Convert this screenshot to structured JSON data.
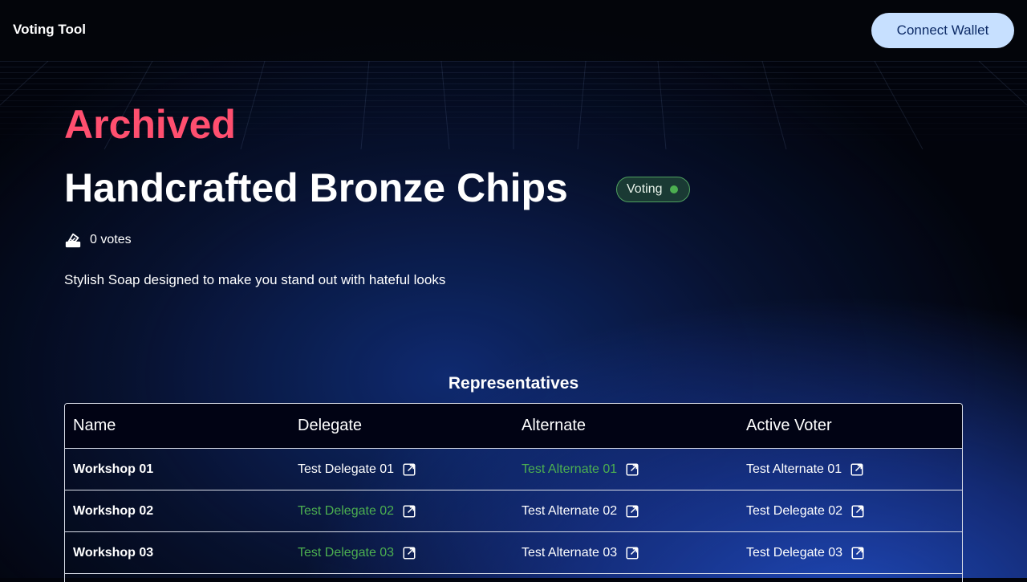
{
  "header": {
    "app_title": "Voting Tool",
    "connect_label": "Connect Wallet"
  },
  "proposal": {
    "status_heading": "Archived",
    "title": "Handcrafted Bronze Chips",
    "badge_label": "Voting",
    "badge_dot_color": "#4caf50",
    "votes_text": "0 votes",
    "description": "Stylish Soap designed to make you stand out with hateful looks"
  },
  "representatives": {
    "section_title": "Representatives",
    "columns": [
      "Name",
      "Delegate",
      "Alternate",
      "Active Voter"
    ],
    "rows": [
      {
        "name": "Workshop 01",
        "delegate": "Test Delegate 01",
        "alternate": "Test Alternate 01",
        "active_voter": "Test Alternate 01",
        "highlight": "alternate"
      },
      {
        "name": "Workshop 02",
        "delegate": "Test Delegate 02",
        "alternate": "Test Alternate 02",
        "active_voter": "Test Delegate 02",
        "highlight": "delegate"
      },
      {
        "name": "Workshop 03",
        "delegate": "Test Delegate 03",
        "alternate": "Test Alternate 03",
        "active_voter": "Test Delegate 03",
        "highlight": "delegate"
      }
    ]
  },
  "colors": {
    "accent_red": "#ff4f6f",
    "active_green": "#4caf50",
    "button_bg": "#c7e0ff"
  },
  "icons": {
    "votes": "ballot-box-icon",
    "link": "external-link-icon"
  }
}
